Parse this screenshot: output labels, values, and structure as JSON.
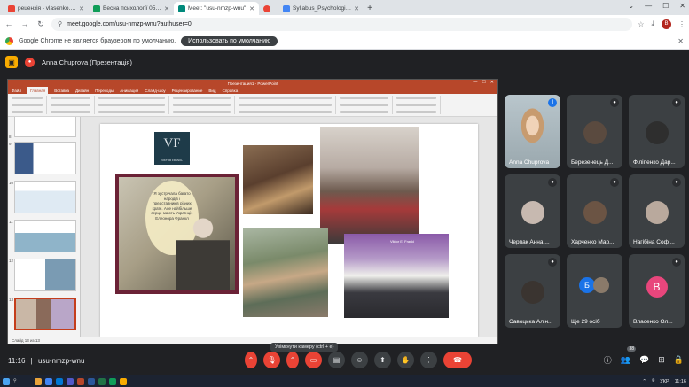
{
  "browser": {
    "tabs": [
      {
        "title": "рецензія - vlasenko.olena@",
        "color": "#ea4335",
        "active": false
      },
      {
        "title": "Весна психології 053-11 Вох",
        "color": "#0f9d58",
        "active": false
      },
      {
        "title": "Meet: \"usu-nmzp-wnu\"",
        "color": "#00897b",
        "active": true
      },
      {
        "title": "",
        "color": "#ea4335",
        "active": false
      },
      {
        "title": "Syllabus_Psychologia-bezpeky",
        "color": "#4285f4",
        "active": false
      }
    ],
    "url": "meet.google.com/usu-nmzp-wnu?authuser=0",
    "profile_initial": "B",
    "infobar_text": "Google Chrome не является браузером по умолчанию.",
    "infobar_button": "Использовать по умолчанию"
  },
  "meet": {
    "presenter_label": "Anna Chuprova (Презентація)",
    "meeting_code": "usu-nmzp-wnu",
    "time": "11:16",
    "tooltip": "Увімкнути камеру (ctrl + e)",
    "participants_badge": "38"
  },
  "ppt": {
    "title": "Презентация1 - PowerPoint",
    "ribbon_tabs": [
      "Файл",
      "Главная",
      "Вставка",
      "Дизайн",
      "Переходы",
      "Анимация",
      "Слайд-шоу",
      "Рецензирование",
      "Вид",
      "Справка"
    ],
    "status": "Слайд 13 из 13",
    "slide": {
      "logo_main": "VF",
      "logo_sub": "VIKTOR FRANKL",
      "quote": "Я зустрічала багато народів і представників різних країн. Але найбільше серце мають Українці» Елеонора Франкл",
      "sign": "Viktor E. Frankl"
    }
  },
  "participants": [
    {
      "name": "Anna Chuprova",
      "type": "video",
      "speaking": true
    },
    {
      "name": "Березенець Д...",
      "type": "avatar",
      "bg": "#5a4a3f",
      "speaking": false
    },
    {
      "name": "Філіпенко Дар...",
      "type": "avatar",
      "bg": "#2e2e2e",
      "speaking": false
    },
    {
      "name": "Черпак Анна ...",
      "type": "avatar",
      "bg": "#c7b9b0",
      "speaking": false
    },
    {
      "name": "Харченко Мар...",
      "type": "avatar",
      "bg": "#6b5444",
      "speaking": false
    },
    {
      "name": "Нагібіна Софі...",
      "type": "avatar",
      "bg": "#b9a99d",
      "speaking": false
    },
    {
      "name": "Савоцька Алін...",
      "type": "avatar",
      "bg": "#3a3430",
      "speaking": false
    },
    {
      "name": "Ще 29 осіб",
      "type": "more",
      "letter": "Б",
      "speaking": false
    },
    {
      "name": "Власенко Ол...",
      "type": "letter",
      "letter": "В",
      "speaking": false
    }
  ],
  "taskbar": {
    "lang": "УКР",
    "time": "11:16"
  }
}
